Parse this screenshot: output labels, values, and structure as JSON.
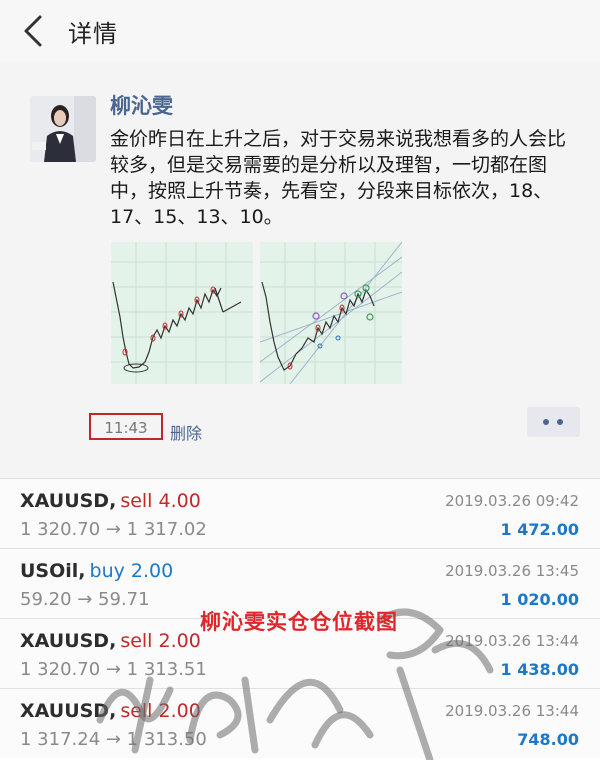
{
  "header": {
    "title": "详情"
  },
  "post": {
    "author": "柳沁雯",
    "content": "金价昨日在上升之后，对于交易来说我想看多的人会比较多，但是交易需要的是分析以及理智，一切都在图中，按照上升节奏，先看空，分段来目标依次，18、17、15、13、10。",
    "time": "11:43",
    "delete_label": "删除"
  },
  "trades": [
    {
      "symbol": "XAUUSD",
      "side": "sell 4.00",
      "prices": "1 320.70 → 1 317.02",
      "date": "2019.03.26 09:42",
      "profit": "1 472.00"
    },
    {
      "symbol": "USOil",
      "side": "buy 2.00",
      "prices": "59.20 → 59.71",
      "date": "2019.03.26 13:45",
      "profit": "1 020.00"
    },
    {
      "symbol": "XAUUSD",
      "side": "sell 2.00",
      "prices": "1 320.70 → 1 313.51",
      "date": "2019.03.26 13:44",
      "profit": "1 438.00"
    },
    {
      "symbol": "XAUUSD",
      "side": "sell 2.00",
      "prices": "1 317.24 → 1 313.50",
      "date": "2019.03.26 13:44",
      "profit": "748.00"
    }
  ],
  "caption": "柳沁雯实仓仓位截图",
  "icons": {
    "back": "chevron-left-icon",
    "more": "more-dots-icon"
  },
  "colors": {
    "accent_blue": "#1c78c8",
    "sell_red": "#c0292a",
    "caption_red": "#e0262b",
    "author_blue": "#4a6690"
  }
}
